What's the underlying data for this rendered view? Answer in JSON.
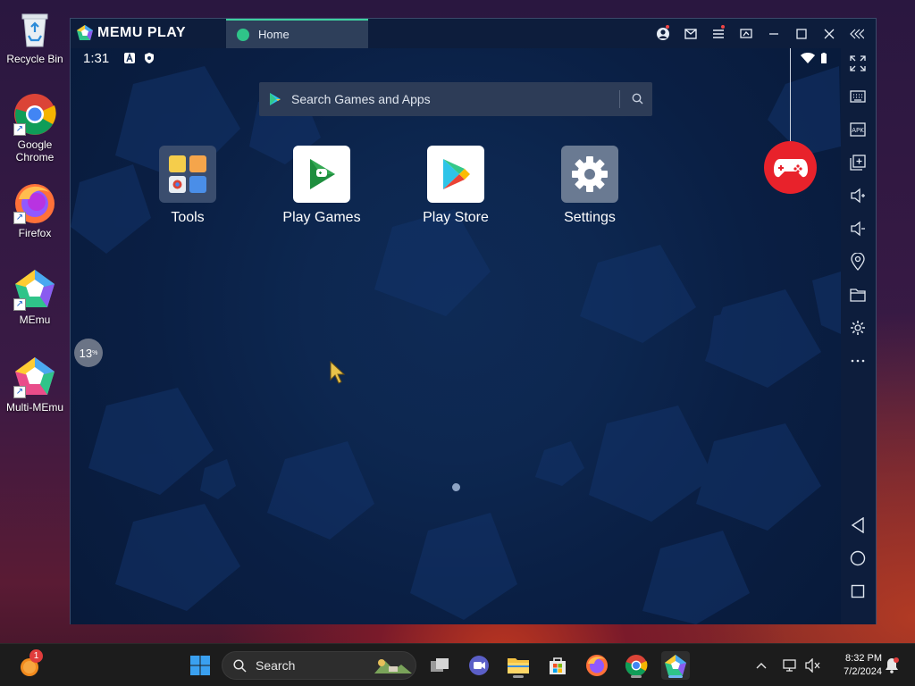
{
  "desktop": {
    "icons": [
      {
        "label": "Recycle Bin"
      },
      {
        "label": "Google\nChrome"
      },
      {
        "label": "Firefox"
      },
      {
        "label": "MEmu"
      },
      {
        "label": "Multi-MEmu"
      }
    ]
  },
  "emulator": {
    "brand": "MEMU PLAY",
    "tab_label": "Home",
    "status": {
      "time": "1:31"
    },
    "search": {
      "placeholder": "Search Games and Apps"
    },
    "apps": [
      {
        "label": "Tools"
      },
      {
        "label": "Play Games"
      },
      {
        "label": "Play Store"
      },
      {
        "label": "Settings"
      }
    ],
    "progress": {
      "value": "13",
      "unit": "%"
    }
  },
  "taskbar": {
    "search_label": "Search",
    "time": "8:32 PM",
    "date": "7/2/2024",
    "badge_count": "1"
  },
  "colors": {
    "screen_bg": "#0d2750",
    "titlebar": "#0d1d3c",
    "tab_accent": "#3fd0a0",
    "gamepad": "#e8222b"
  }
}
